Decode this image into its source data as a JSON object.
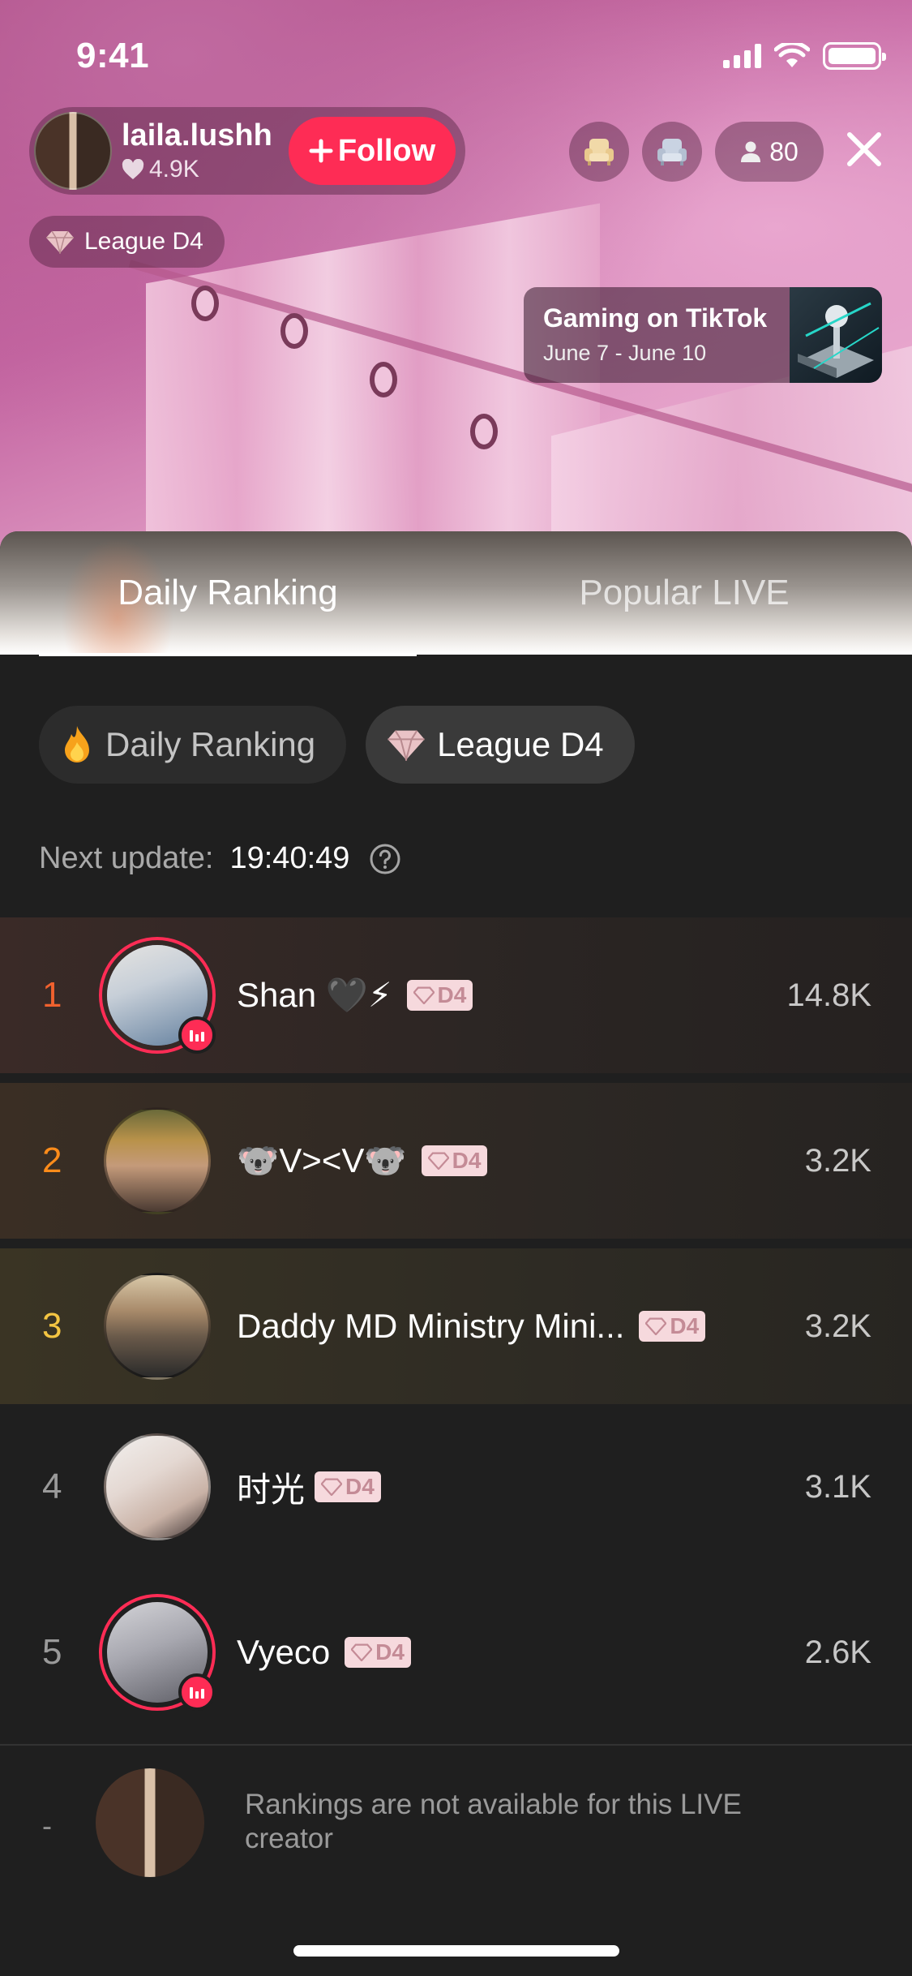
{
  "status_bar": {
    "time": "9:41"
  },
  "host": {
    "name": "laila.lushh",
    "likes": "4.9K",
    "follow_label": "Follow",
    "league": "League D4"
  },
  "viewers": {
    "count": "80"
  },
  "promo": {
    "title": "Gaming on TikTok",
    "dates": "June 7 - June 10"
  },
  "tabs": [
    {
      "label": "Daily Ranking",
      "active": true
    },
    {
      "label": "Popular LIVE",
      "active": false
    }
  ],
  "filters": [
    {
      "label": "Daily Ranking",
      "icon": "flame-icon",
      "selected": false
    },
    {
      "label": "League D4",
      "icon": "diamond-icon",
      "selected": true
    }
  ],
  "next_update": {
    "label": "Next update:",
    "time": "19:40:49"
  },
  "rankings": [
    {
      "rank": "1",
      "name": "Shan 🖤⚡",
      "badge": "D4",
      "score": "14.8K",
      "live": true
    },
    {
      "rank": "2",
      "name": "🐨V><V🐨",
      "badge": "D4",
      "score": "3.2K",
      "live": false
    },
    {
      "rank": "3",
      "name": "Daddy MD Ministry Mini...",
      "badge": "D4",
      "score": "3.2K",
      "live": false
    },
    {
      "rank": "4",
      "name": "时光",
      "badge": "D4",
      "score": "3.1K",
      "live": false
    },
    {
      "rank": "5",
      "name": "Vyeco",
      "badge": "D4",
      "score": "2.6K",
      "live": true
    }
  ],
  "self": {
    "rank": "-",
    "message": "Rankings are not available for this LIVE creator"
  },
  "colors": {
    "accent": "#fe2c55",
    "rank1": "#f0612e",
    "rank2": "#ff8c1a",
    "rank3": "#f4c542",
    "badge_bg": "#f6d9dd"
  }
}
